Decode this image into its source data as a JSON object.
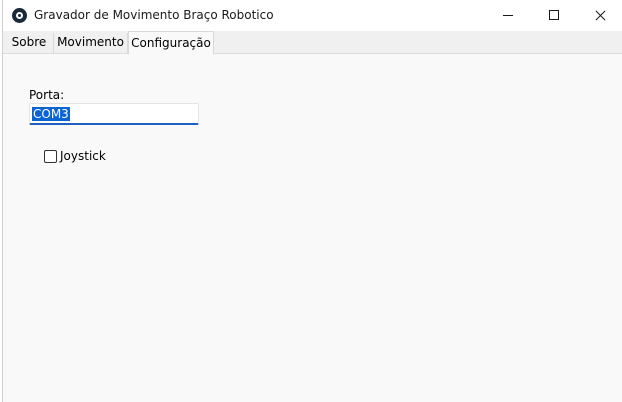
{
  "window": {
    "title": "Gravador de Movimento Braço Robotico",
    "app_icon": "app-icon"
  },
  "tabs": [
    {
      "label": "Sobre",
      "selected": false
    },
    {
      "label": "Movimento",
      "selected": false
    },
    {
      "label": "Configuração",
      "selected": true
    }
  ],
  "config": {
    "port_label": "Porta:",
    "port_value": "COM3",
    "joystick_label": "Joystick",
    "joystick_checked": false
  }
}
